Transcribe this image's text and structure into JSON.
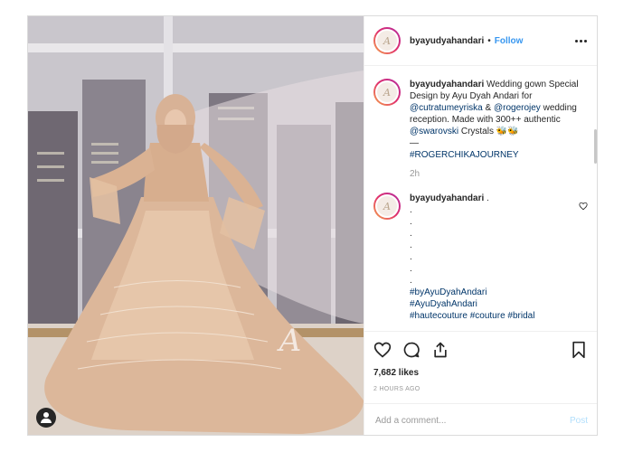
{
  "header": {
    "username": "byayudyahandari",
    "separator": "•",
    "follow_label": "Follow",
    "avatar_glyph": "A",
    "more_icon": "ellipsis-icon"
  },
  "caption": {
    "username": "byayudyahandari",
    "text_1": " Wedding gown Special Design by Ayu Dyah Andari for ",
    "mention_1": "@cutratumeyriska",
    "text_2": " & ",
    "mention_2": "@rogerojey",
    "text_3": " wedding reception. Made with 300++ authentic ",
    "mention_3": "@swarovski",
    "text_4": " Crystals 🐝🐝",
    "divider": "—",
    "hashtag": "#ROGERCHIKAJOURNEY",
    "time": "2h"
  },
  "comment": {
    "username": "byayudyahandari",
    "suffix": " .",
    "dots": [
      ".",
      ".",
      ".",
      ".",
      ".",
      ".",
      "."
    ],
    "tags_1": "#byAyuDyahAndari",
    "tags_2": "#AyuDyahAndari",
    "tags_3": "#hautecouture #couture #bridal"
  },
  "actions": {
    "icons": [
      "heart-icon",
      "comment-icon",
      "share-icon",
      "bookmark-icon"
    ],
    "likes": "7,682 likes",
    "posted": "2 HOURS AGO"
  },
  "composer": {
    "placeholder": "Add a comment...",
    "post_label": "Post"
  },
  "colors": {
    "link": "#003569",
    "follow": "#3897f0",
    "muted": "#999999",
    "post_disabled": "#b2dffc"
  }
}
